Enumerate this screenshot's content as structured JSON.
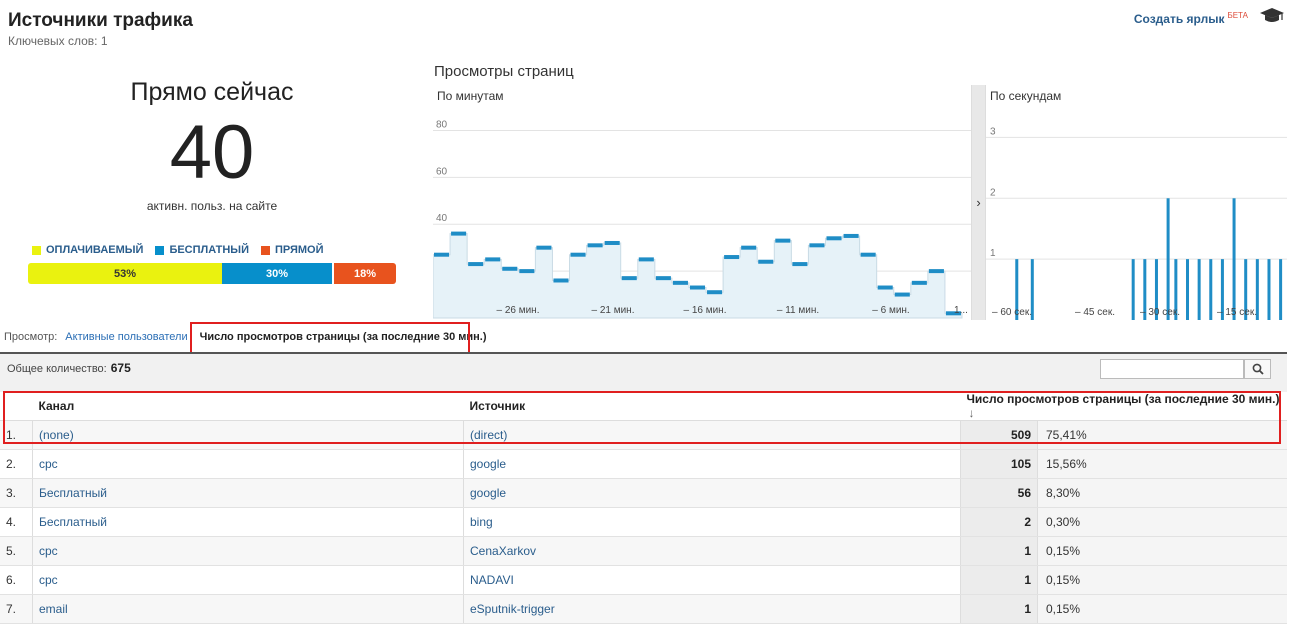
{
  "header": {
    "title": "Источники трафика",
    "subtitle": "Ключевых слов: 1",
    "shortcut_label": "Создать ярлык",
    "beta_label": "БЕТА"
  },
  "now": {
    "heading": "Прямо сейчас",
    "active_count": "40",
    "caption": "активн. польз. на сайте",
    "legend": [
      {
        "label": "ОПЛАЧИВАЕМЫЙ",
        "color": "#eaf20f"
      },
      {
        "label": "БЕСПЛАТНЫЙ",
        "color": "#078fcb"
      },
      {
        "label": "ПРЯМОЙ",
        "color": "#e8531e"
      }
    ],
    "shares": [
      {
        "label": "53%",
        "value": 53
      },
      {
        "label": "30%",
        "value": 30
      },
      {
        "label": "18%",
        "value": 18
      }
    ]
  },
  "pageviews": {
    "title": "Просмотры страниц",
    "minutes_label": "По минутам",
    "seconds_label": "По секундам",
    "expand_icon": "chevron-right-icon"
  },
  "chart_data": [
    {
      "type": "line",
      "title": "По минутам",
      "ylim": [
        0,
        90
      ],
      "yticks": [
        "20",
        "40",
        "60",
        "80"
      ],
      "xticks": [
        "– 26 мин.",
        "– 21 мин.",
        "– 16 мин.",
        "– 11 мин.",
        "– 6 мин.",
        "1..."
      ],
      "values": [
        27,
        36,
        23,
        25,
        21,
        20,
        30,
        16,
        27,
        31,
        32,
        17,
        25,
        17,
        15,
        13,
        11,
        26,
        30,
        24,
        33,
        23,
        31,
        34,
        35,
        27,
        13,
        10,
        15,
        20,
        2
      ]
    },
    {
      "type": "bar",
      "title": "По секундам",
      "ylim": [
        0,
        3.5
      ],
      "yticks": [
        "1",
        "2",
        "3"
      ],
      "xticks": [
        "– 60 сек.",
        "– 45 сек.",
        "– 30 сек.",
        "– 15 сек."
      ],
      "values": [
        0,
        0,
        0,
        0,
        0,
        0,
        1,
        0,
        0,
        0,
        1,
        0,
        0,
        0,
        0,
        0,
        0,
        0,
        0,
        0,
        0,
        0,
        0,
        0,
        0,
        0,
        0,
        0,
        0,
        0,
        0,
        0,
        0,
        0,
        0,
        0,
        1,
        0,
        0,
        1,
        0,
        0,
        1,
        0,
        0,
        2,
        0,
        1,
        0,
        0,
        1,
        0,
        0,
        1,
        0,
        0,
        1,
        0,
        0,
        1,
        0,
        0,
        2,
        0,
        0,
        1,
        0,
        0,
        1,
        0,
        0,
        1,
        0,
        0,
        1
      ]
    }
  ],
  "view": {
    "label": "Просмотр:",
    "option_users": "Активные пользователи",
    "option_pageviews": "Число просмотров страницы (за последние 30 мин.)"
  },
  "summary": {
    "label": "Общее количество:",
    "total": "675"
  },
  "table": {
    "columns": [
      "Канал",
      "Источник",
      "Число просмотров страницы (за последние 30 мин.)"
    ],
    "rows": [
      {
        "n": "1.",
        "channel": "(none)",
        "source": "(direct)",
        "views": "509",
        "pct": "75,41%"
      },
      {
        "n": "2.",
        "channel": "cpc",
        "source": "google",
        "views": "105",
        "pct": "15,56%"
      },
      {
        "n": "3.",
        "channel": "Бесплатный",
        "source": "google",
        "views": "56",
        "pct": "8,30%"
      },
      {
        "n": "4.",
        "channel": "Бесплатный",
        "source": "bing",
        "views": "2",
        "pct": "0,30%"
      },
      {
        "n": "5.",
        "channel": "cpc",
        "source": "CenaXarkov",
        "views": "1",
        "pct": "0,15%"
      },
      {
        "n": "6.",
        "channel": "cpc",
        "source": "NADAVI",
        "views": "1",
        "pct": "0,15%"
      },
      {
        "n": "7.",
        "channel": "email",
        "source": "eSputnik-trigger",
        "views": "1",
        "pct": "0,15%"
      }
    ]
  }
}
